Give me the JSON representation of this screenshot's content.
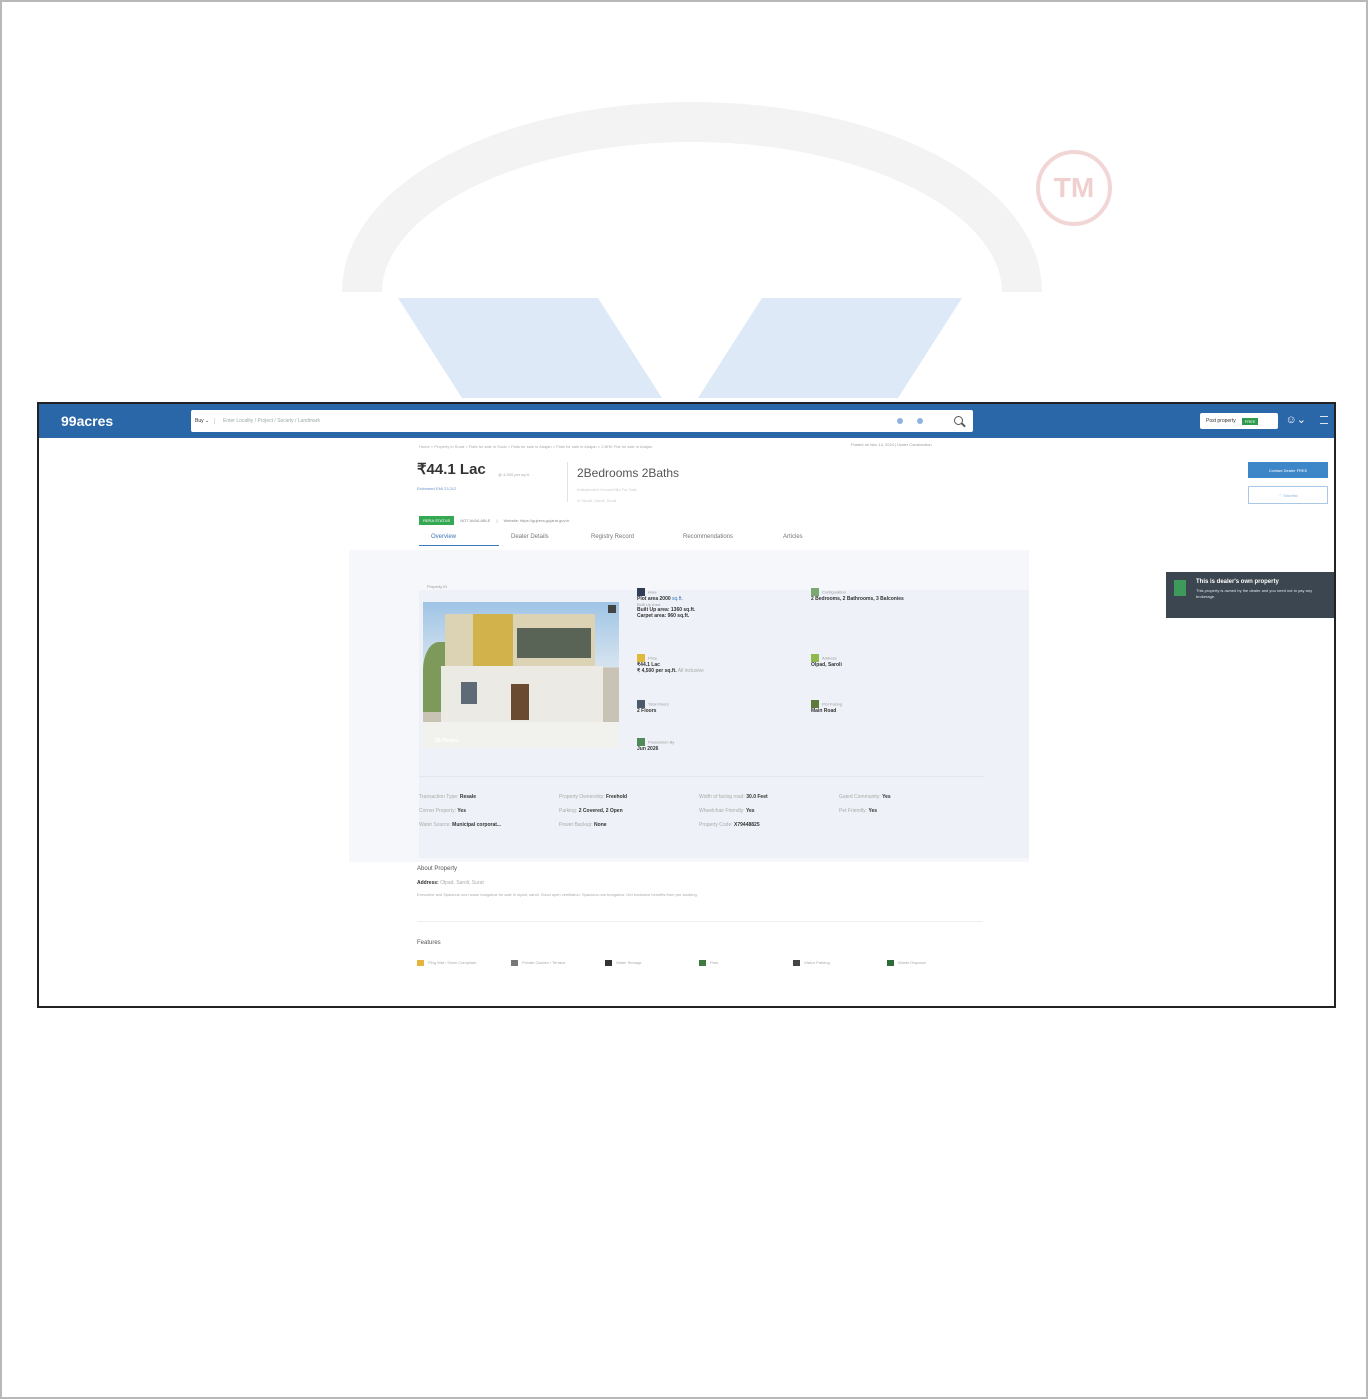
{
  "header": {
    "logo": "99acres",
    "buy_label": "Buy ⌄",
    "search_placeholder": "Enter Locality / Project / Society / Landmark",
    "post_property_label": "Post property",
    "post_property_badge": "FREE"
  },
  "breadcrumb": "Home > Property in Surat > Flats for sale in Surat > Flats for sale in Adajan > Flats for sale in Adajan > 2 BHK Flat for sale in Adajan",
  "posted_info": "Posted on Nov 14, 2024 | Under Construction",
  "listing": {
    "price": "₹44.1 Lac",
    "price_per_sqft": "@ 4,500 per sq.ft.",
    "emi": "Estimated EMI 23,312",
    "title": "2Bedrooms 2Baths",
    "subtitle": "Independent House/Villa For Sale",
    "location": "in Olpad, Saroli, Surat"
  },
  "status_badges": {
    "rera": "RERA STATUS",
    "not_available": "NOT AVAILABLE",
    "website": "Website: https://gujrera.gujarat.gov.in"
  },
  "tabs": [
    "Overview",
    "Dealer Details",
    "Registry Record",
    "Recommendations",
    "Articles"
  ],
  "overview": {
    "property_id": "Property ID",
    "photos_label": "35 Photos",
    "area_label": "Area",
    "plot_area": "Plot area 2000",
    "plot_area_unit": "sq.ft.",
    "built_up_label": "Built Up Area",
    "built_up": "Built Up area: 1360 sq.ft.",
    "carpet": "Carpet area: 960 sq.ft.",
    "configuration_label": "Configuration",
    "configuration": "2 Bedrooms, 2 Bathrooms, 3 Balconies",
    "price_label": "Price",
    "price_value": "₹44.1 Lac",
    "price_sqft": "₹ 4,500 per sq.ft.",
    "price_sqft_note": "All inclusive",
    "address_label": "Address",
    "address": "Olpad, Saroli",
    "total_floors_label": "Total Floors",
    "total_floors": "2 Floors",
    "facing_label": "Plot Facing",
    "facing": "Main Road",
    "possession_label": "Possession By",
    "possession": "Jun 2026"
  },
  "details": [
    {
      "label": "Transaction Type:",
      "value": "Resale"
    },
    {
      "label": "Property Ownership:",
      "value": "Freehold"
    },
    {
      "label": "Width of facing road:",
      "value": "30.0 Feet"
    },
    {
      "label": "Gated Community:",
      "value": "Yes"
    },
    {
      "label": "Corner Property:",
      "value": "Yes"
    },
    {
      "label": "Parking:",
      "value": "2 Covered, 2 Open"
    },
    {
      "label": "Wheelchair Friendly:",
      "value": "Yes"
    },
    {
      "label": "Pet Friendly:",
      "value": "Yes"
    },
    {
      "label": "Water Source:",
      "value": "Municipal corporat..."
    },
    {
      "label": "Power Backup:",
      "value": "None"
    },
    {
      "label": "Property Code:",
      "value": "X79448825"
    },
    {
      "label": "",
      "value": ""
    }
  ],
  "about": {
    "heading": "About Property",
    "address_label": "Address:",
    "address": "Olpad, Saroli, Surat",
    "description": "Executive and Spacious row house bungalow for sale in olpad, saroli. Good open ventilation. Spacious row bungalow. Get exclusive benefits from pre-booking."
  },
  "features": {
    "heading": "Features",
    "items": [
      "Ping Wat / Swim Compliant",
      "Private Garden / Terrace",
      "Water Storage",
      "Park",
      "Visitor Parking",
      "Waste Disposal"
    ]
  },
  "actions": {
    "contact": "Contact Dealer",
    "contact_badge": "FREE",
    "shortlist": "♡ Shortlist"
  },
  "dealer_card": {
    "title": "This is dealer's own property",
    "text": "This property is owned by the dealer and you need not to pay any brokerage."
  },
  "watermark_mark": "TM",
  "colors": {
    "brand": "#2a67a8",
    "accent": "#3d75b9",
    "rera_green": "#34a853"
  }
}
